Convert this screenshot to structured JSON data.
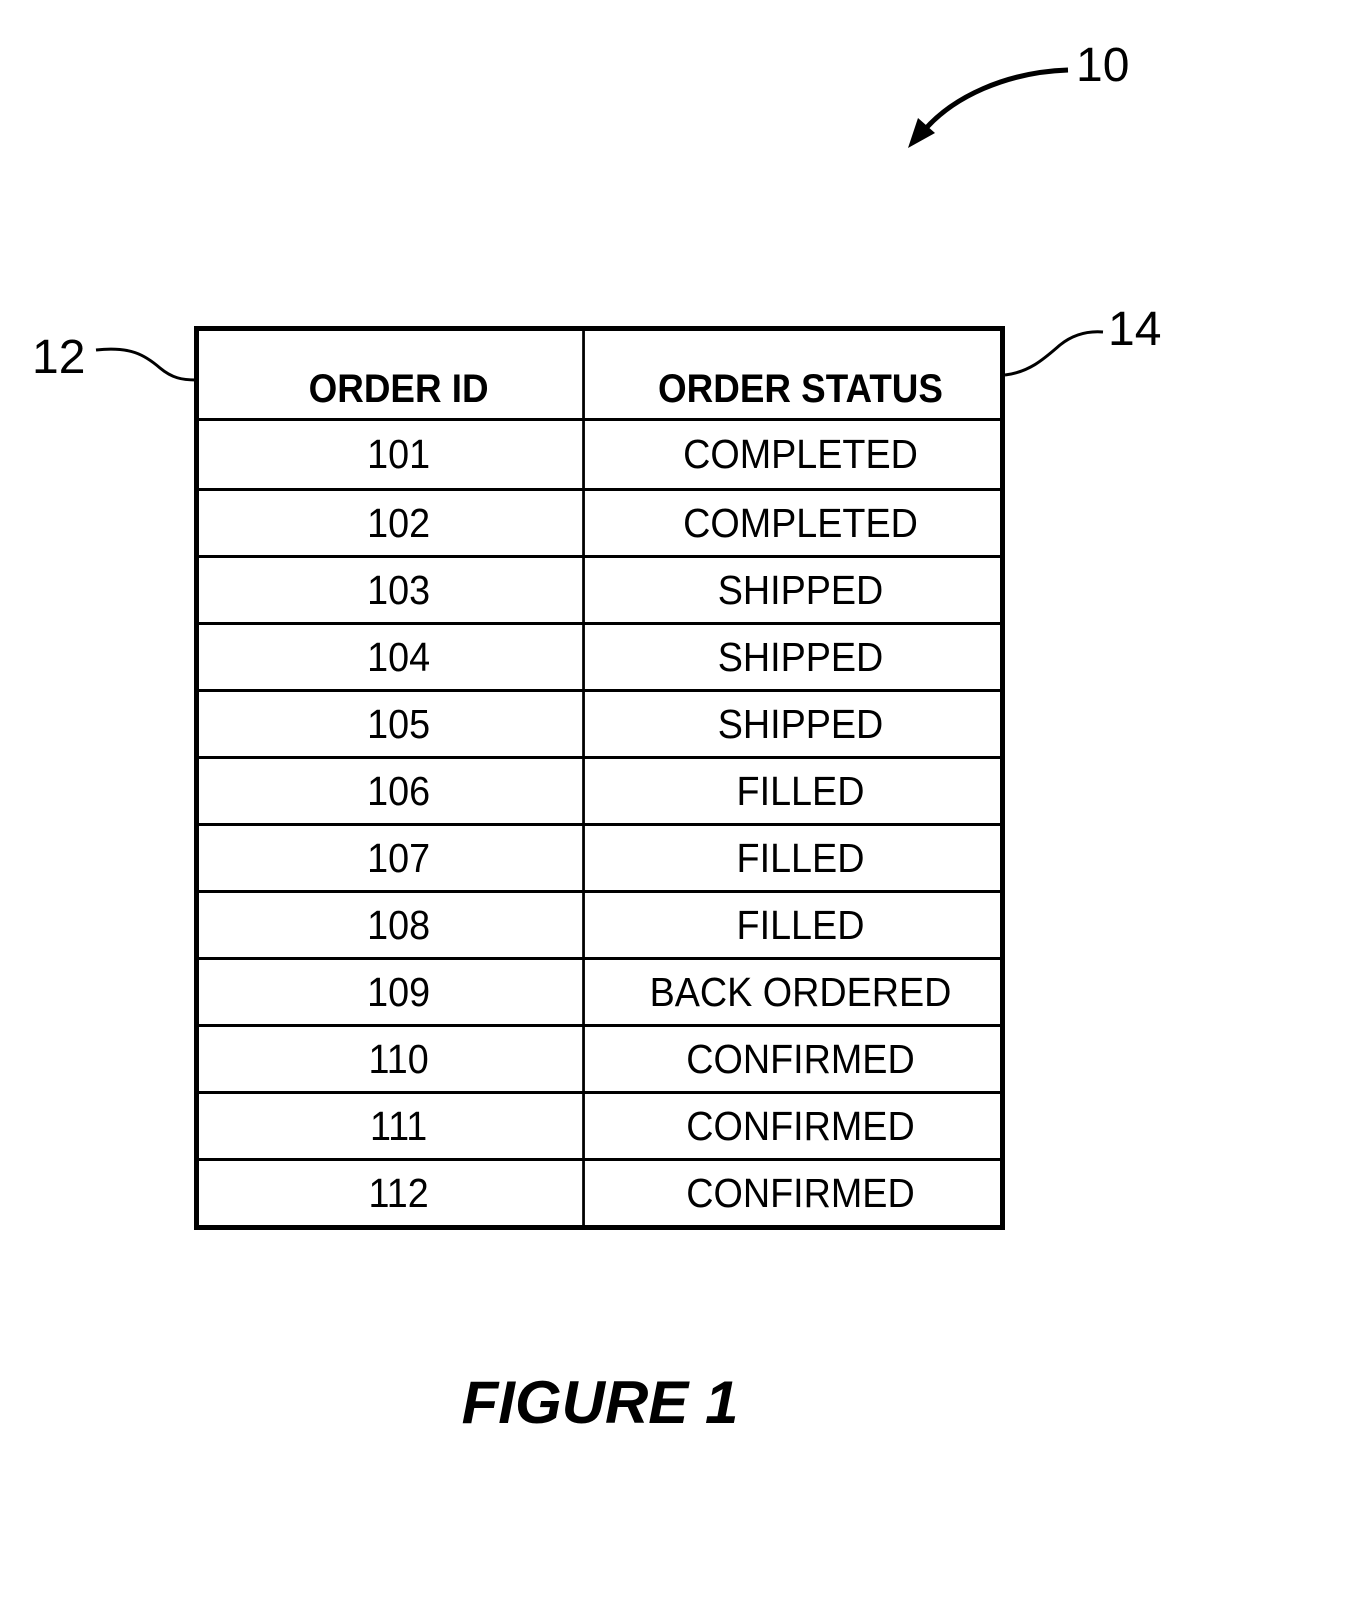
{
  "figure": {
    "caption": "FIGURE 1",
    "reference_numerals": {
      "figure": "10",
      "order_id_column": "12",
      "order_status_column": "14"
    }
  },
  "table": {
    "headers": [
      "ORDER ID",
      "ORDER STATUS"
    ],
    "rows": [
      {
        "order_id": "101",
        "status": "COMPLETED"
      },
      {
        "order_id": "102",
        "status": "COMPLETED"
      },
      {
        "order_id": "103",
        "status": "SHIPPED"
      },
      {
        "order_id": "104",
        "status": "SHIPPED"
      },
      {
        "order_id": "105",
        "status": "SHIPPED"
      },
      {
        "order_id": "106",
        "status": "FILLED"
      },
      {
        "order_id": "107",
        "status": "FILLED"
      },
      {
        "order_id": "108",
        "status": "FILLED"
      },
      {
        "order_id": "109",
        "status": "BACK ORDERED"
      },
      {
        "order_id": "110",
        "status": "CONFIRMED"
      },
      {
        "order_id": "111",
        "status": "CONFIRMED"
      },
      {
        "order_id": "112",
        "status": "CONFIRMED"
      }
    ]
  }
}
